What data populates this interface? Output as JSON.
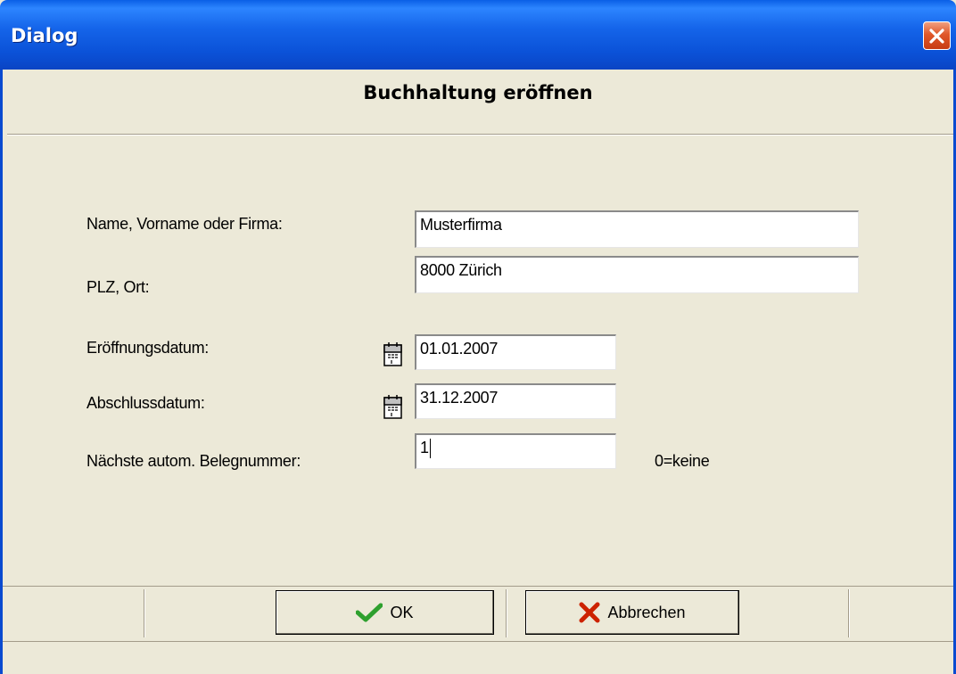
{
  "window": {
    "title": "Dialog"
  },
  "heading": "Buchhaltung eröffnen",
  "form": {
    "name": {
      "label": "Name, Vorname oder Firma:",
      "value": "Musterfirma"
    },
    "plz": {
      "label": "PLZ, Ort:",
      "value": "8000 Zürich"
    },
    "start_date": {
      "label": "Eröffnungsdatum:",
      "value": "01.01.2007"
    },
    "end_date": {
      "label": "Abschlussdatum:",
      "value": "31.12.2007"
    },
    "next_doc": {
      "label": "Nächste autom. Belegnummer:",
      "value": "1",
      "hint": "0=keine"
    }
  },
  "buttons": {
    "ok": "OK",
    "cancel": "Abbrechen"
  },
  "icons": {
    "close": "close-icon",
    "calendar": "calendar-icon",
    "ok": "checkmark-icon",
    "cancel": "x-icon"
  },
  "colors": {
    "titlebar": "#0a52d8",
    "close": "#e0582a",
    "face": "#ece9d8",
    "ok_icon": "#2ea02e",
    "cancel_icon": "#cc2200"
  }
}
